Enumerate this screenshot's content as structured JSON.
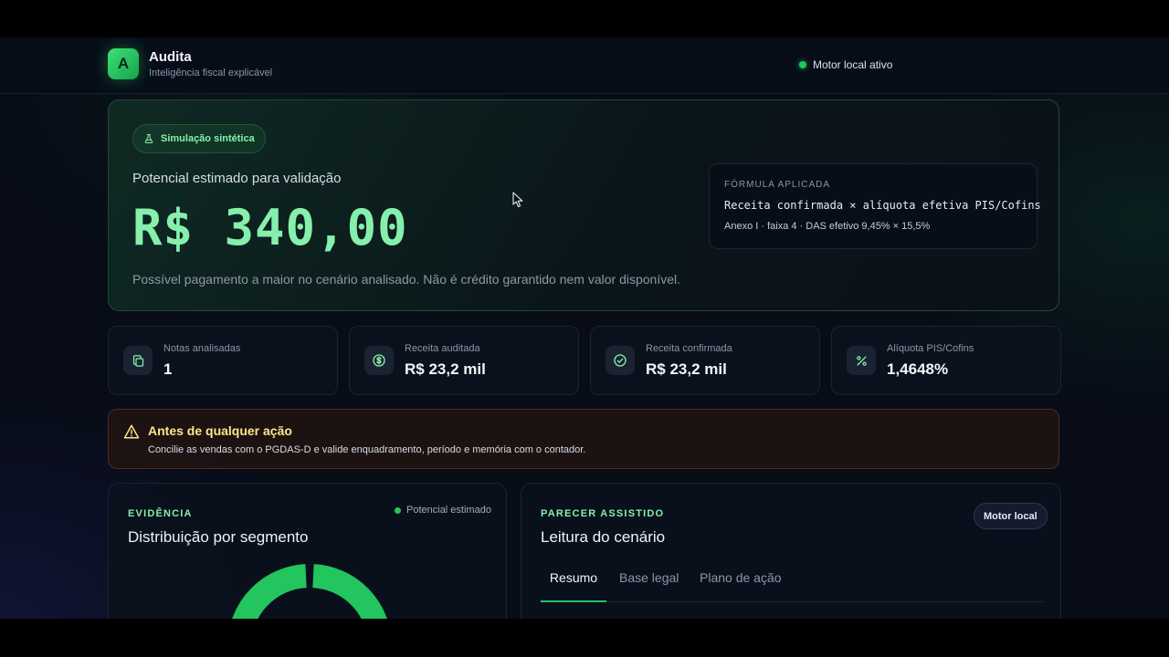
{
  "header": {
    "logo_letter": "A",
    "brand_name": "Audita",
    "brand_tagline": "Inteligência fiscal explicável",
    "engine_status": "Motor local ativo",
    "status_color": "#22c55e"
  },
  "hero": {
    "badge_icon": "flask-icon",
    "badge_label": "Simulação sintética",
    "label": "Potencial estimado para validação",
    "value": "R$ 340,00",
    "note": "Possível pagamento a maior no cenário analisado. Não é crédito garantido nem valor disponível.",
    "formula": {
      "title": "FÓRMULA APLICADA",
      "expression": "Receita confirmada × alíquota efetiva PIS/Cofins",
      "detail": "Anexo I · faixa 4 · DAS efetivo 9,45% × 15,5%"
    }
  },
  "stats": [
    {
      "icon": "documents-icon",
      "label": "Notas analisadas",
      "value": "1"
    },
    {
      "icon": "dollar-circle-icon",
      "label": "Receita auditada",
      "value": "R$ 23,2 mil"
    },
    {
      "icon": "check-circle-icon",
      "label": "Receita confirmada",
      "value": "R$ 23,2 mil"
    },
    {
      "icon": "percent-icon",
      "label": "Alíquota PIS/Cofins",
      "value": "1,4648%"
    }
  ],
  "warning": {
    "icon": "warning-triangle-icon",
    "title": "Antes de qualquer ação",
    "text": "Concilie as vendas com o PGDAS-D e valide enquadramento, período e memória com o contador."
  },
  "evidence": {
    "overline": "EVIDÊNCIA",
    "title": "Distribuição por segmento",
    "legend": "Potencial estimado",
    "accent": "#22c55e"
  },
  "opinion": {
    "overline": "PARECER ASSISTIDO",
    "title": "Leitura do cenário",
    "engine_pill": "Motor local",
    "tabs": [
      {
        "label": "Resumo",
        "active": true
      },
      {
        "label": "Base legal",
        "active": false
      },
      {
        "label": "Plano de ação",
        "active": false
      }
    ]
  }
}
